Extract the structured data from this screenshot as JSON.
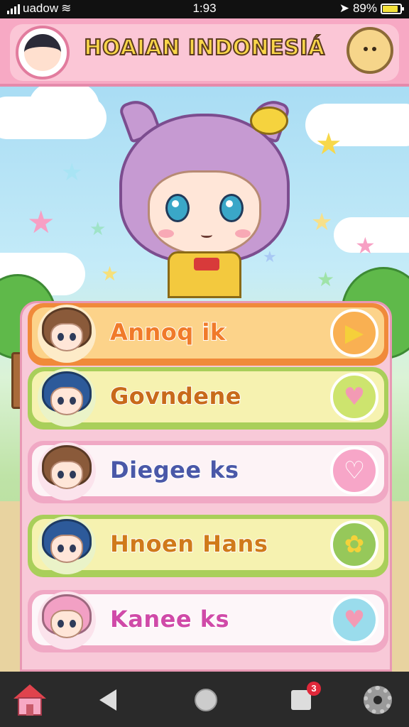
{
  "statusbar": {
    "carrier": "uadow",
    "time": "1:93",
    "battery_text": "89%",
    "battery_level": 0.89,
    "wifi_icon": "wifi-icon",
    "location_icon": "location-arrow-icon"
  },
  "header": {
    "title": "HOAIAN INDONESIÁ",
    "avatar_icon": "profile-avatar-icon",
    "mascot_icon": "mascot-bun-icon"
  },
  "menu": {
    "items": [
      {
        "label": "Annoq ik",
        "label_color": "#f07a2a",
        "bg": "#fcd38a",
        "border": "#f08a3a",
        "btn_bg": "#f9b052",
        "btn_icon": "▶",
        "btn_icon_color": "#f5d03a",
        "hair_color": "#8a5a3a",
        "char_bg": "#fdebc8",
        "icon_name": "play-icon"
      },
      {
        "label": "Govndene",
        "label_color": "#c86a1a",
        "bg": "#f6f2b0",
        "border": "#a9cf5a",
        "btn_bg": "#cde46e",
        "btn_icon": "♥",
        "btn_icon_color": "#f39ab4",
        "hair_color": "#2d5a9a",
        "char_bg": "#eaf3c8",
        "icon_name": "heart-icon"
      },
      {
        "label": "Diegee ks",
        "label_color": "#4a58a8",
        "bg": "#fdf3f6",
        "border": "#f0a8c4",
        "btn_bg": "#f7a6c8",
        "btn_icon": "♡",
        "btn_icon_color": "#ffffff",
        "hair_color": "#8a5a3a",
        "char_bg": "#fbe3ec",
        "icon_name": "heart-outline-icon"
      },
      {
        "label": "Hnoen Hans",
        "label_color": "#d07a1a",
        "bg": "#f6f2b0",
        "border": "#a9cf5a",
        "btn_bg": "#96c85a",
        "btn_icon": "✿",
        "btn_icon_color": "#f4d23a",
        "hair_color": "#2d5a9a",
        "char_bg": "#eaf3c8",
        "icon_name": "flower-icon"
      },
      {
        "label": "Kanee ks",
        "label_color": "#d04aa8",
        "bg": "#fdf6f9",
        "border": "#f0a8c4",
        "btn_bg": "#9adcec",
        "btn_icon": "♥",
        "btn_icon_color": "#f39ab4",
        "hair_color": "#f2a0c4",
        "char_bg": "#fbe3ec",
        "icon_name": "heart-icon"
      }
    ]
  },
  "navbar": {
    "home_icon": "home-icon",
    "back_icon": "back-icon",
    "home_button_icon": "home-button-icon",
    "recents_icon": "recents-icon",
    "recents_badge": "3",
    "settings_icon": "gear-icon"
  }
}
